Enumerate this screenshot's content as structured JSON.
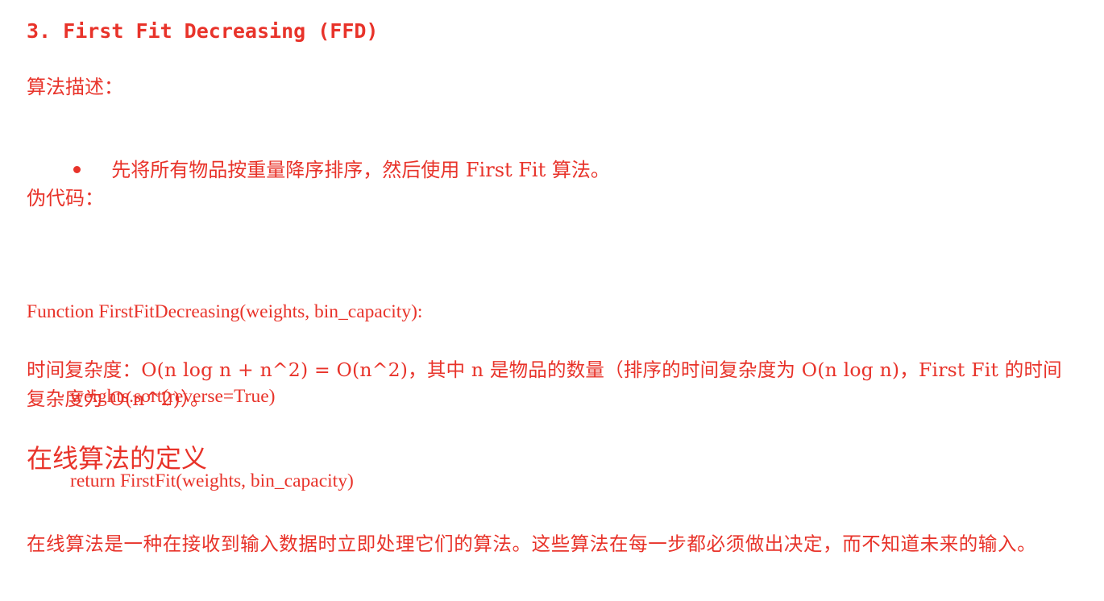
{
  "section": {
    "heading": "3. First Fit Decreasing (FFD)"
  },
  "description": {
    "label": "算法描述：",
    "bullets": [
      "先将所有物品按重量降序排序，然后使用 First Fit 算法。"
    ]
  },
  "pseudocode": {
    "label": "伪代码：",
    "lines": [
      "Function FirstFitDecreasing(weights, bin_capacity):",
      "weights.sort(reverse=True)",
      "return FirstFit(weights, bin_capacity)"
    ]
  },
  "complexity": {
    "text": "时间复杂度：O(n log n + n^2) = O(n^2)，其中 n 是物品的数量（排序的时间复杂度为 O(n log n)，First Fit 的时间复杂度为 O(n^2)）。"
  },
  "online": {
    "heading": "在线算法的定义",
    "paragraph": "在线算法是一种在接收到输入数据时立即处理它们的算法。这些算法在每一步都必须做出决定，而不知道未来的输入。"
  },
  "colors": {
    "text": "#e8332a",
    "background": "#ffffff"
  }
}
